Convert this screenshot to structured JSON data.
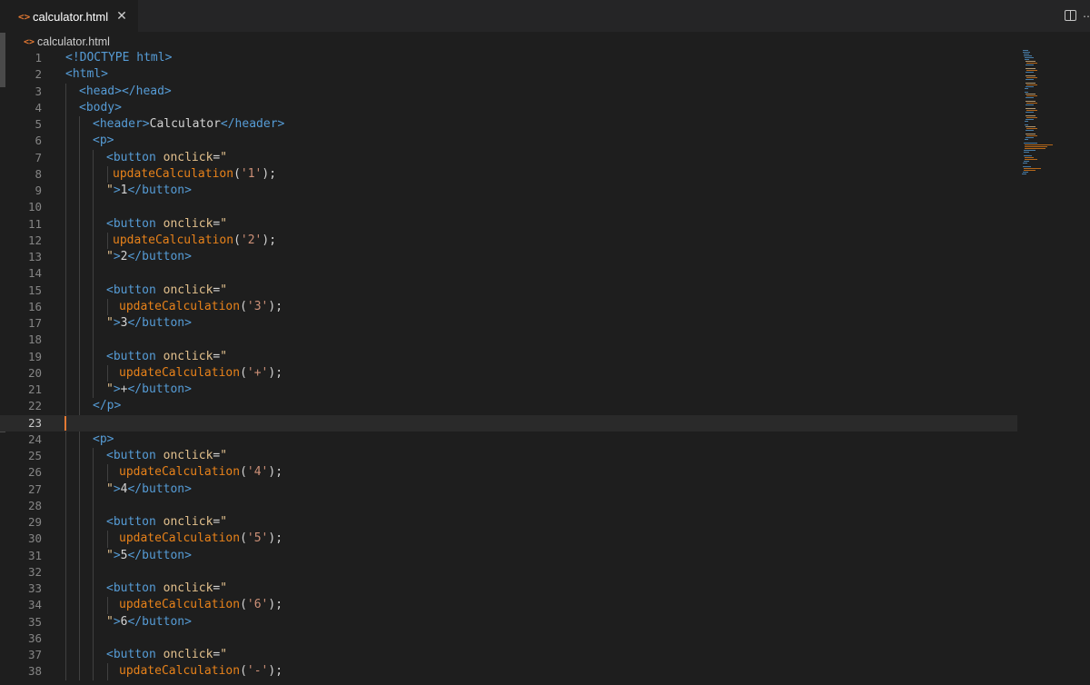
{
  "tab": {
    "file_icon": "<>",
    "label": "calculator.html",
    "close_icon": "✕"
  },
  "toolbar": {
    "split_icon": "split-editor-icon",
    "more_icon": "…"
  },
  "breadcrumb": {
    "icon": "<>",
    "label": "calculator.html"
  },
  "editor": {
    "current_line": 23,
    "lines": [
      {
        "n": "1",
        "indent": 0,
        "tokens": [
          [
            "t-tag",
            "<!DOCTYPE html>"
          ]
        ]
      },
      {
        "n": "2",
        "indent": 0,
        "tokens": [
          [
            "t-tag",
            "<html>"
          ]
        ]
      },
      {
        "n": "3",
        "indent": 1,
        "tokens": [
          [
            "t-tag",
            "<head></head>"
          ]
        ]
      },
      {
        "n": "4",
        "indent": 1,
        "tokens": [
          [
            "t-tag",
            "<body>"
          ]
        ]
      },
      {
        "n": "5",
        "indent": 2,
        "tokens": [
          [
            "t-tag",
            "<header>"
          ],
          [
            "t-text",
            "Calculator"
          ],
          [
            "t-tag",
            "</header>"
          ]
        ]
      },
      {
        "n": "6",
        "indent": 2,
        "tokens": [
          [
            "t-tag",
            "<p>"
          ]
        ]
      },
      {
        "n": "7",
        "indent": 3,
        "tokens": [
          [
            "t-tag",
            "<button "
          ],
          [
            "t-attr",
            "onclick"
          ],
          [
            "t-punc",
            "="
          ],
          [
            "t-quote",
            "\""
          ]
        ]
      },
      {
        "n": "8",
        "indent": 3,
        "pad": 1,
        "tokens": [
          [
            "t-fn",
            "updateCalculation"
          ],
          [
            "t-punc",
            "("
          ],
          [
            "t-str",
            "'1'"
          ],
          [
            "t-punc",
            ");"
          ]
        ]
      },
      {
        "n": "9",
        "indent": 3,
        "tokens": [
          [
            "t-quote",
            "\""
          ],
          [
            "t-tag",
            ">"
          ],
          [
            "t-text",
            "1"
          ],
          [
            "t-tag",
            "</button>"
          ]
        ]
      },
      {
        "n": "10",
        "indent": 3,
        "tokens": []
      },
      {
        "n": "11",
        "indent": 3,
        "tokens": [
          [
            "t-tag",
            "<button "
          ],
          [
            "t-attr",
            "onclick"
          ],
          [
            "t-punc",
            "="
          ],
          [
            "t-quote",
            "\""
          ]
        ]
      },
      {
        "n": "12",
        "indent": 3,
        "pad": 1,
        "tokens": [
          [
            "t-fn",
            "updateCalculation"
          ],
          [
            "t-punc",
            "("
          ],
          [
            "t-str",
            "'2'"
          ],
          [
            "t-punc",
            ");"
          ]
        ]
      },
      {
        "n": "13",
        "indent": 3,
        "tokens": [
          [
            "t-quote",
            "\""
          ],
          [
            "t-tag",
            ">"
          ],
          [
            "t-text",
            "2"
          ],
          [
            "t-tag",
            "</button>"
          ]
        ]
      },
      {
        "n": "14",
        "indent": 3,
        "tokens": []
      },
      {
        "n": "15",
        "indent": 3,
        "tokens": [
          [
            "t-tag",
            "<button "
          ],
          [
            "t-attr",
            "onclick"
          ],
          [
            "t-punc",
            "="
          ],
          [
            "t-quote",
            "\""
          ]
        ]
      },
      {
        "n": "16",
        "indent": 3,
        "pad": 2,
        "tokens": [
          [
            "t-fn",
            "updateCalculation"
          ],
          [
            "t-punc",
            "("
          ],
          [
            "t-str",
            "'3'"
          ],
          [
            "t-punc",
            ");"
          ]
        ]
      },
      {
        "n": "17",
        "indent": 3,
        "tokens": [
          [
            "t-quote",
            "\""
          ],
          [
            "t-tag",
            ">"
          ],
          [
            "t-text",
            "3"
          ],
          [
            "t-tag",
            "</button>"
          ]
        ]
      },
      {
        "n": "18",
        "indent": 3,
        "tokens": []
      },
      {
        "n": "19",
        "indent": 3,
        "tokens": [
          [
            "t-tag",
            "<button "
          ],
          [
            "t-attr",
            "onclick"
          ],
          [
            "t-punc",
            "="
          ],
          [
            "t-quote",
            "\""
          ]
        ]
      },
      {
        "n": "20",
        "indent": 3,
        "pad": 2,
        "tokens": [
          [
            "t-fn",
            "updateCalculation"
          ],
          [
            "t-punc",
            "("
          ],
          [
            "t-str",
            "'+'"
          ],
          [
            "t-punc",
            ");"
          ]
        ]
      },
      {
        "n": "21",
        "indent": 3,
        "tokens": [
          [
            "t-quote",
            "\""
          ],
          [
            "t-tag",
            ">"
          ],
          [
            "t-text",
            "+"
          ],
          [
            "t-tag",
            "</button>"
          ]
        ]
      },
      {
        "n": "22",
        "indent": 2,
        "tokens": [
          [
            "t-tag",
            "</p>"
          ]
        ]
      },
      {
        "n": "23",
        "indent": 0,
        "tokens": []
      },
      {
        "n": "24",
        "indent": 2,
        "tokens": [
          [
            "t-tag",
            "<p>"
          ]
        ]
      },
      {
        "n": "25",
        "indent": 3,
        "tokens": [
          [
            "t-tag",
            "<button "
          ],
          [
            "t-attr",
            "onclick"
          ],
          [
            "t-punc",
            "="
          ],
          [
            "t-quote",
            "\""
          ]
        ]
      },
      {
        "n": "26",
        "indent": 3,
        "pad": 2,
        "tokens": [
          [
            "t-fn",
            "updateCalculation"
          ],
          [
            "t-punc",
            "("
          ],
          [
            "t-str",
            "'4'"
          ],
          [
            "t-punc",
            ");"
          ]
        ]
      },
      {
        "n": "27",
        "indent": 3,
        "tokens": [
          [
            "t-quote",
            "\""
          ],
          [
            "t-tag",
            ">"
          ],
          [
            "t-text",
            "4"
          ],
          [
            "t-tag",
            "</button>"
          ]
        ]
      },
      {
        "n": "28",
        "indent": 3,
        "tokens": []
      },
      {
        "n": "29",
        "indent": 3,
        "tokens": [
          [
            "t-tag",
            "<button "
          ],
          [
            "t-attr",
            "onclick"
          ],
          [
            "t-punc",
            "="
          ],
          [
            "t-quote",
            "\""
          ]
        ]
      },
      {
        "n": "30",
        "indent": 3,
        "pad": 2,
        "tokens": [
          [
            "t-fn",
            "updateCalculation"
          ],
          [
            "t-punc",
            "("
          ],
          [
            "t-str",
            "'5'"
          ],
          [
            "t-punc",
            ");"
          ]
        ]
      },
      {
        "n": "31",
        "indent": 3,
        "tokens": [
          [
            "t-quote",
            "\""
          ],
          [
            "t-tag",
            ">"
          ],
          [
            "t-text",
            "5"
          ],
          [
            "t-tag",
            "</button>"
          ]
        ]
      },
      {
        "n": "32",
        "indent": 3,
        "tokens": []
      },
      {
        "n": "33",
        "indent": 3,
        "tokens": [
          [
            "t-tag",
            "<button "
          ],
          [
            "t-attr",
            "onclick"
          ],
          [
            "t-punc",
            "="
          ],
          [
            "t-quote",
            "\""
          ]
        ]
      },
      {
        "n": "34",
        "indent": 3,
        "pad": 2,
        "tokens": [
          [
            "t-fn",
            "updateCalculation"
          ],
          [
            "t-punc",
            "("
          ],
          [
            "t-str",
            "'6'"
          ],
          [
            "t-punc",
            ");"
          ]
        ]
      },
      {
        "n": "35",
        "indent": 3,
        "tokens": [
          [
            "t-quote",
            "\""
          ],
          [
            "t-tag",
            ">"
          ],
          [
            "t-text",
            "6"
          ],
          [
            "t-tag",
            "</button>"
          ]
        ]
      },
      {
        "n": "36",
        "indent": 3,
        "tokens": []
      },
      {
        "n": "37",
        "indent": 3,
        "tokens": [
          [
            "t-tag",
            "<button "
          ],
          [
            "t-attr",
            "onclick"
          ],
          [
            "t-punc",
            "="
          ],
          [
            "t-quote",
            "\""
          ]
        ]
      },
      {
        "n": "38",
        "indent": 3,
        "pad": 2,
        "tokens": [
          [
            "t-fn",
            "updateCalculation"
          ],
          [
            "t-punc",
            "("
          ],
          [
            "t-str",
            "'-'"
          ],
          [
            "t-punc",
            ");"
          ]
        ]
      }
    ]
  },
  "colors": {
    "background": "#1e1e1e",
    "tag": "#569cd6",
    "attribute": "#e2c08d",
    "function": "#e8821a",
    "string": "#ce9178",
    "cursor": "#e37933"
  }
}
